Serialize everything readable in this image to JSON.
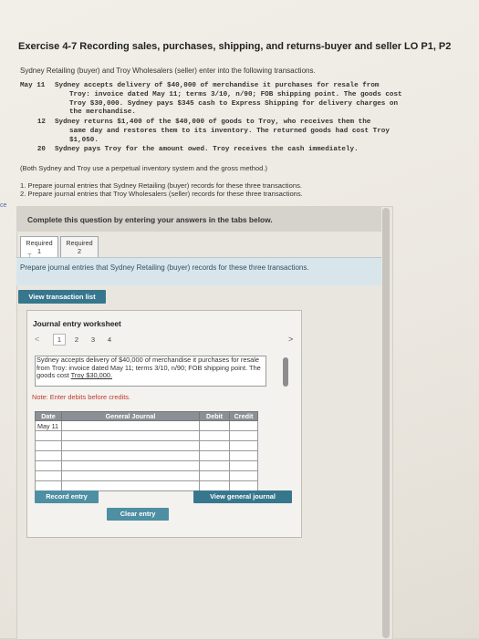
{
  "exercise": {
    "title": "Exercise 4-7 Recording sales, purchases, shipping, and returns-buyer and seller LO P1, P2",
    "intro": "Sydney Retailing (buyer) and Troy Wholesalers (seller) enter into the following transactions.",
    "transactions": [
      {
        "date": "May 11",
        "lines": [
          "Sydney accepts delivery of $40,000 of merchandise it purchases for resale from",
          "Troy: invoice dated May 11; terms 3/10, n/90; FOB shipping point. The goods cost",
          "Troy $30,000. Sydney pays $345 cash to Express Shipping for delivery charges on",
          "the merchandise."
        ]
      },
      {
        "date": "12",
        "lines": [
          "Sydney returns $1,400 of the $40,000 of goods to Troy, who receives them the",
          "same day and restores them to its inventory. The returned goods had cost Troy",
          "$1,050."
        ]
      },
      {
        "date": "20",
        "lines": [
          "Sydney pays Troy for the amount owed. Troy receives the cash immediately."
        ]
      }
    ],
    "note": "(Both Sydney and Troy use a perpetual inventory system and the gross method.)",
    "requirements": [
      "1. Prepare journal entries that Sydney Retailing (buyer) records for these three transactions.",
      "2. Prepare journal entries that Troy Wholesalers (seller) records for these three transactions."
    ],
    "side_label": "ce"
  },
  "question": {
    "instruction": "Complete this question by entering your answers in the tabs below.",
    "tabs": [
      {
        "line1": "Required",
        "line2": "1",
        "active": true
      },
      {
        "line1": "Required",
        "line2": "2",
        "active": false
      }
    ],
    "prompt": "Prepare journal entries that Sydney Retailing (buyer) records for these three transactions.",
    "view_transaction_list": "View transaction list"
  },
  "worksheet": {
    "title": "Journal entry worksheet",
    "prev": "<",
    "next": ">",
    "pages": [
      "1",
      "2",
      "3",
      "4"
    ],
    "active_page": 1,
    "description": "Sydney accepts delivery of $40,000 of merchandise it purchases for resale from Troy: invoice dated May 11; terms 3/10, n/90; FOB shipping point. The goods cost",
    "description_underlined": "Troy $30,000.",
    "note": "Note: Enter debits before credits.",
    "columns": {
      "date": "Date",
      "general_journal": "General Journal",
      "debit": "Debit",
      "credit": "Credit"
    },
    "rows": [
      {
        "date": "May 11",
        "account": "",
        "debit": "",
        "credit": ""
      },
      {
        "date": "",
        "account": "",
        "debit": "",
        "credit": ""
      },
      {
        "date": "",
        "account": "",
        "debit": "",
        "credit": ""
      },
      {
        "date": "",
        "account": "",
        "debit": "",
        "credit": ""
      },
      {
        "date": "",
        "account": "",
        "debit": "",
        "credit": ""
      },
      {
        "date": "",
        "account": "",
        "debit": "",
        "credit": ""
      },
      {
        "date": "",
        "account": "",
        "debit": "",
        "credit": ""
      }
    ],
    "record_entry": "Record entry",
    "clear_entry": "Clear entry",
    "view_general_journal": "View general journal"
  }
}
